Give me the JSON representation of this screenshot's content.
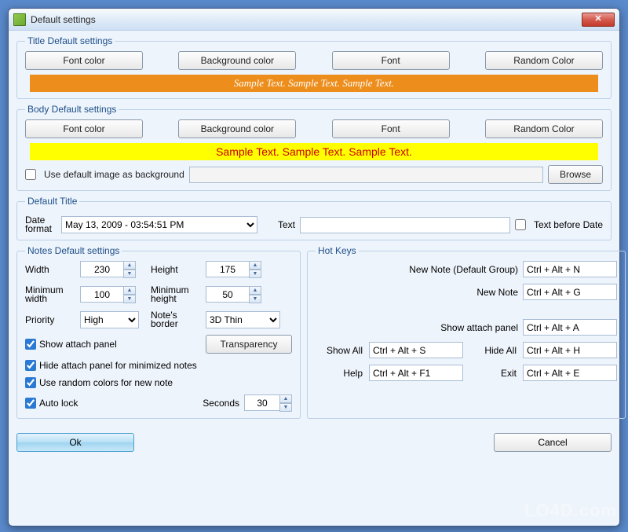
{
  "window": {
    "title": "Default settings"
  },
  "title_section": {
    "legend": "Title Default settings",
    "font_color": "Font color",
    "bg_color": "Background color",
    "font": "Font",
    "random": "Random Color",
    "sample": "Sample Text. Sample Text. Sample Text."
  },
  "body_section": {
    "legend": "Body Default settings",
    "font_color": "Font color",
    "bg_color": "Background color",
    "font": "Font",
    "random": "Random Color",
    "sample": "Sample Text. Sample Text. Sample Text.",
    "use_default_image": "Use default image as background",
    "browse": "Browse"
  },
  "default_title": {
    "legend": "Default Title",
    "date_format_label": "Date format",
    "date_format_value": "May 13, 2009 - 03:54:51 PM",
    "text_label": "Text",
    "text_value": "",
    "text_before_date": "Text before Date"
  },
  "notes": {
    "legend": "Notes Default settings",
    "width_label": "Width",
    "width": "230",
    "height_label": "Height",
    "height": "175",
    "min_width_label": "Minimum width",
    "min_width": "100",
    "min_height_label": "Minimum height",
    "min_height": "50",
    "priority_label": "Priority",
    "priority": "High",
    "border_label": "Note's border",
    "border": "3D Thin",
    "show_attach": "Show attach panel",
    "transparency": "Transparency",
    "hide_attach": "Hide attach panel for minimized notes",
    "random_colors": "Use random colors for new note",
    "auto_lock": "Auto lock",
    "seconds_label": "Seconds",
    "seconds": "30"
  },
  "hotkeys": {
    "legend": "Hot Keys",
    "new_note_default_label": "New Note (Default Group)",
    "new_note_default": "Ctrl + Alt + N",
    "new_note_label": "New Note",
    "new_note": "Ctrl + Alt + G",
    "show_attach_label": "Show attach panel",
    "show_attach": "Ctrl + Alt + A",
    "show_all_label": "Show All",
    "show_all": "Ctrl + Alt + S",
    "hide_all_label": "Hide All",
    "hide_all": "Ctrl + Alt + H",
    "help_label": "Help",
    "help": "Ctrl + Alt + F1",
    "exit_label": "Exit",
    "exit": "Ctrl + Alt + E"
  },
  "footer": {
    "ok": "Ok",
    "cancel": "Cancel"
  },
  "watermark": "LO4D.com"
}
